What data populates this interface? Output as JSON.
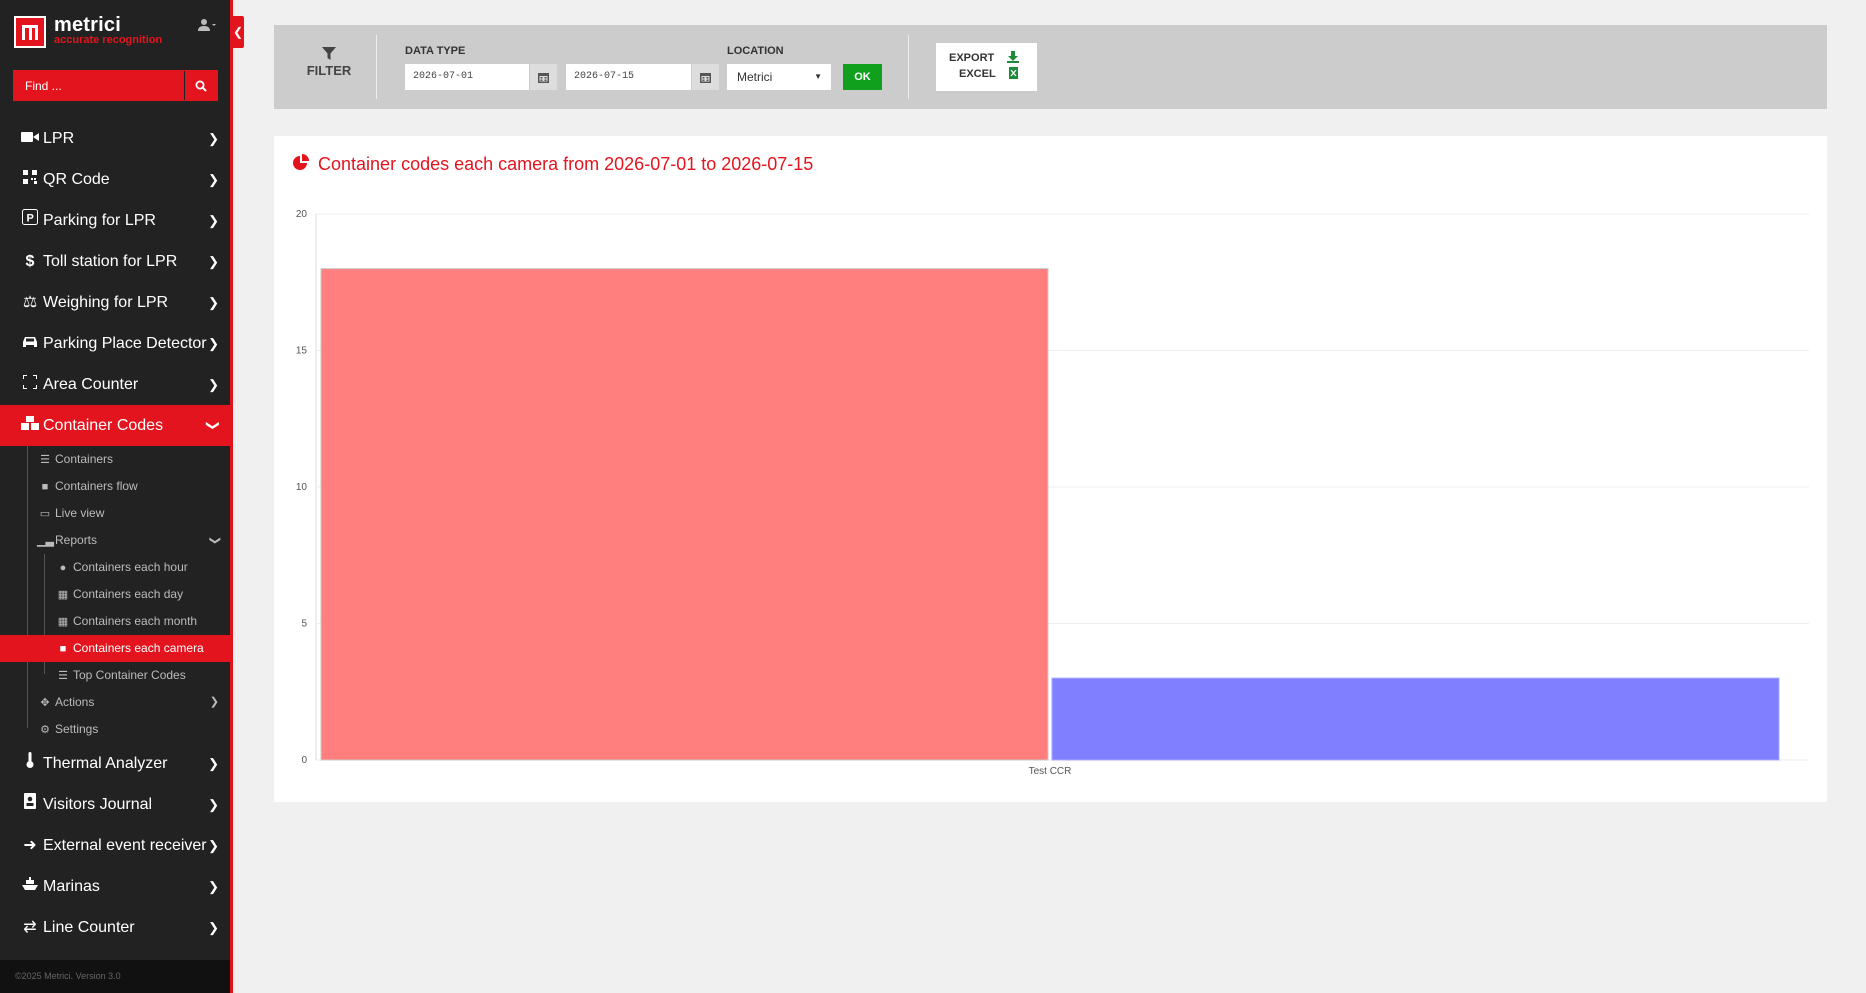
{
  "app": {
    "brand_name": "metrici",
    "brand_tagline": "accurate recognition",
    "footer": "©2025 Metrici. Version 3.0"
  },
  "search": {
    "placeholder": "Find ..."
  },
  "menu": {
    "lpr": "LPR",
    "qr": "QR Code",
    "parking": "Parking for LPR",
    "toll": "Toll station for LPR",
    "weighing": "Weighing for LPR",
    "ppd": "Parking Place Detector",
    "area": "Area Counter",
    "container": "Container Codes",
    "sub": {
      "containers": "Containers",
      "flow": "Containers flow",
      "live": "Live view",
      "reports": "Reports",
      "hour": "Containers each hour",
      "day": "Containers each day",
      "month": "Containers each month",
      "camera": "Containers each camera",
      "top": "Top Container Codes",
      "actions": "Actions",
      "settings": "Settings"
    },
    "thermal": "Thermal Analyzer",
    "visitors": "Visitors Journal",
    "external": "External event receiver",
    "marinas": "Marinas",
    "line": "Line Counter"
  },
  "filter": {
    "label": "FILTER",
    "data_type_label": "DATA TYPE",
    "date_from": "2026-07-01",
    "date_to": "2026-07-15",
    "location_label": "LOCATION",
    "location_value": "Metrici",
    "ok_label": "OK",
    "export_line1": "EXPORT",
    "export_line2": "EXCEL"
  },
  "card": {
    "title": "Container codes each camera from 2026-07-01 to 2026-07-15"
  },
  "chart_data": {
    "type": "bar",
    "categories": [
      "Test CCR"
    ],
    "series": [
      {
        "values": [
          18
        ],
        "color": "#ff7f7f"
      },
      {
        "values": [
          3
        ],
        "color": "#7f7fff"
      }
    ],
    "yticks": [
      0,
      5,
      10,
      15,
      20
    ],
    "ylim": [
      0,
      20
    ],
    "grid": true
  },
  "colors": {
    "accent": "#e3141e",
    "ok": "#11a01e"
  }
}
